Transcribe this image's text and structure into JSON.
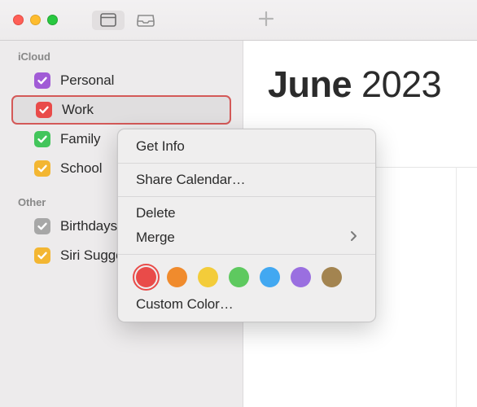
{
  "sidebar": {
    "sections": [
      {
        "header": "iCloud",
        "items": [
          {
            "label": "Personal",
            "color": "#a15bd6",
            "checked": true,
            "selected": false
          },
          {
            "label": "Work",
            "color": "#e94b49",
            "checked": true,
            "selected": true
          },
          {
            "label": "Family",
            "color": "#43c55b",
            "checked": true,
            "selected": false
          },
          {
            "label": "School",
            "color": "#f3b632",
            "checked": true,
            "selected": false
          }
        ]
      },
      {
        "header": "Other",
        "items": [
          {
            "label": "Birthdays",
            "color": "#a7a7a7",
            "checked": true,
            "selected": false
          },
          {
            "label": "Siri Suggestions",
            "color": "#f3b632",
            "checked": true,
            "selected": false
          }
        ]
      }
    ]
  },
  "main": {
    "month": "June",
    "year": "2023"
  },
  "context_menu": {
    "get_info": "Get Info",
    "share": "Share Calendar…",
    "delete": "Delete",
    "merge": "Merge",
    "custom_color": "Custom Color…",
    "colors": [
      {
        "hex": "#e94b49",
        "ring": "#e94b49",
        "selected": true
      },
      {
        "hex": "#f08b2d",
        "selected": false
      },
      {
        "hex": "#f3cc3a",
        "selected": false
      },
      {
        "hex": "#5ec95f",
        "selected": false
      },
      {
        "hex": "#42a8f1",
        "selected": false
      },
      {
        "hex": "#9a6fe0",
        "selected": false
      },
      {
        "hex": "#a38450",
        "selected": false
      }
    ]
  }
}
